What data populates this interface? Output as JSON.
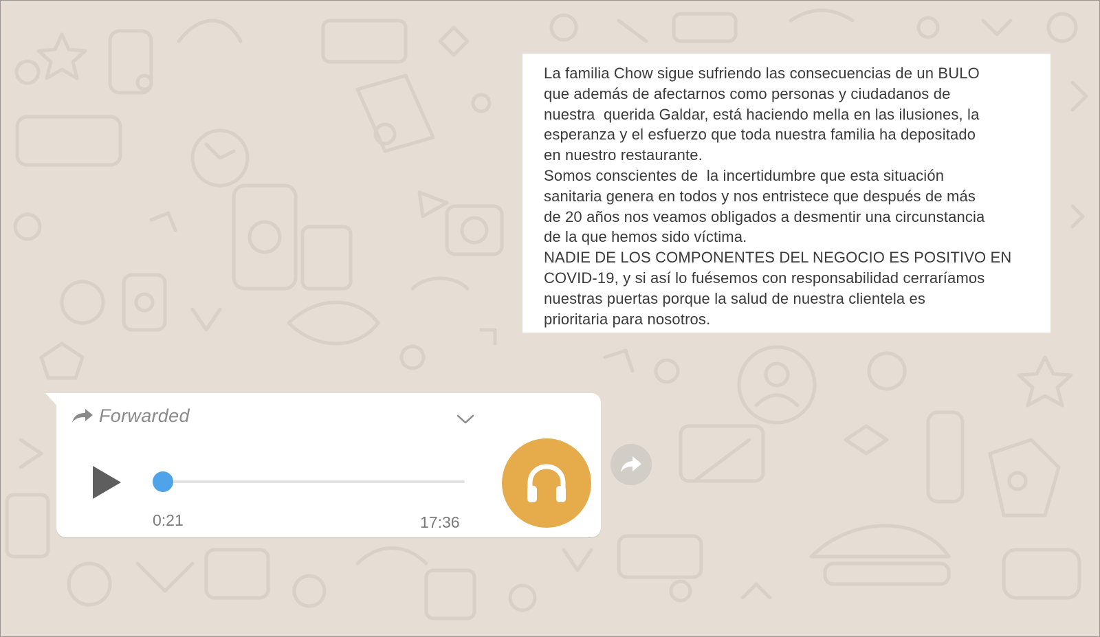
{
  "colors": {
    "wallpaper": "#e6ded5",
    "doodle": "#d8d0c6",
    "bubble": "#ffffff",
    "progress_knob": "#4fa3e8",
    "avatar": "#e6ac4c",
    "secondary_text": "#7a7a7a"
  },
  "text_card": {
    "paragraphs": [
      "La familia Chow sigue sufriendo las consecuencias de un BULO\nque además de afectarnos como personas y ciudadanos de\nnuestra  querida Galdar, está haciendo mella en las ilusiones, la\nesperanza y el esfuerzo que toda nuestra familia ha depositado\nen nuestro restaurante.",
      "Somos conscientes de  la incertidumbre que esta situación\nsanitaria genera en todos y nos entristece que después de más\nde 20 años nos veamos obligados a desmentir una circunstancia\nde la que hemos sido víctima.",
      "NADIE DE LOS COMPONENTES DEL NEGOCIO ES POSITIVO EN\nCOVID-19, y si así lo fuésemos con responsabilidad cerraríamos\nnuestras puertas porque la salud de nuestra clientela es\nprioritaria para nosotros."
    ]
  },
  "voice_message": {
    "forwarded_label": "Forwarded",
    "duration": "0:21",
    "timestamp": "17:36",
    "progress": 0.0,
    "icons": {
      "forwarded": "forward-arrow-icon",
      "menu": "chevron-down-icon",
      "play": "play-icon",
      "avatar": "headphones-icon",
      "share": "forward-arrow-icon"
    }
  }
}
